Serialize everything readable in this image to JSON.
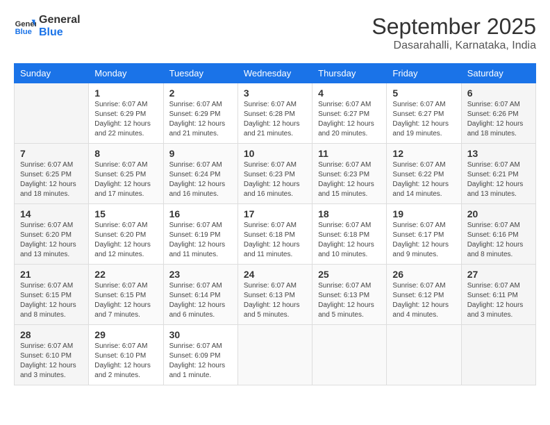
{
  "header": {
    "logo_line1": "General",
    "logo_line2": "Blue",
    "month": "September 2025",
    "location": "Dasarahalli, Karnataka, India"
  },
  "days_of_week": [
    "Sunday",
    "Monday",
    "Tuesday",
    "Wednesday",
    "Thursday",
    "Friday",
    "Saturday"
  ],
  "weeks": [
    [
      {
        "num": "",
        "empty": true
      },
      {
        "num": "1",
        "sunrise": "6:07 AM",
        "sunset": "6:29 PM",
        "daylight": "12 hours and 22 minutes."
      },
      {
        "num": "2",
        "sunrise": "6:07 AM",
        "sunset": "6:29 PM",
        "daylight": "12 hours and 21 minutes."
      },
      {
        "num": "3",
        "sunrise": "6:07 AM",
        "sunset": "6:28 PM",
        "daylight": "12 hours and 21 minutes."
      },
      {
        "num": "4",
        "sunrise": "6:07 AM",
        "sunset": "6:27 PM",
        "daylight": "12 hours and 20 minutes."
      },
      {
        "num": "5",
        "sunrise": "6:07 AM",
        "sunset": "6:27 PM",
        "daylight": "12 hours and 19 minutes."
      },
      {
        "num": "6",
        "sunrise": "6:07 AM",
        "sunset": "6:26 PM",
        "daylight": "12 hours and 18 minutes."
      }
    ],
    [
      {
        "num": "7",
        "sunrise": "6:07 AM",
        "sunset": "6:25 PM",
        "daylight": "12 hours and 18 minutes."
      },
      {
        "num": "8",
        "sunrise": "6:07 AM",
        "sunset": "6:25 PM",
        "daylight": "12 hours and 17 minutes."
      },
      {
        "num": "9",
        "sunrise": "6:07 AM",
        "sunset": "6:24 PM",
        "daylight": "12 hours and 16 minutes."
      },
      {
        "num": "10",
        "sunrise": "6:07 AM",
        "sunset": "6:23 PM",
        "daylight": "12 hours and 16 minutes."
      },
      {
        "num": "11",
        "sunrise": "6:07 AM",
        "sunset": "6:23 PM",
        "daylight": "12 hours and 15 minutes."
      },
      {
        "num": "12",
        "sunrise": "6:07 AM",
        "sunset": "6:22 PM",
        "daylight": "12 hours and 14 minutes."
      },
      {
        "num": "13",
        "sunrise": "6:07 AM",
        "sunset": "6:21 PM",
        "daylight": "12 hours and 13 minutes."
      }
    ],
    [
      {
        "num": "14",
        "sunrise": "6:07 AM",
        "sunset": "6:20 PM",
        "daylight": "12 hours and 13 minutes."
      },
      {
        "num": "15",
        "sunrise": "6:07 AM",
        "sunset": "6:20 PM",
        "daylight": "12 hours and 12 minutes."
      },
      {
        "num": "16",
        "sunrise": "6:07 AM",
        "sunset": "6:19 PM",
        "daylight": "12 hours and 11 minutes."
      },
      {
        "num": "17",
        "sunrise": "6:07 AM",
        "sunset": "6:18 PM",
        "daylight": "12 hours and 11 minutes."
      },
      {
        "num": "18",
        "sunrise": "6:07 AM",
        "sunset": "6:18 PM",
        "daylight": "12 hours and 10 minutes."
      },
      {
        "num": "19",
        "sunrise": "6:07 AM",
        "sunset": "6:17 PM",
        "daylight": "12 hours and 9 minutes."
      },
      {
        "num": "20",
        "sunrise": "6:07 AM",
        "sunset": "6:16 PM",
        "daylight": "12 hours and 8 minutes."
      }
    ],
    [
      {
        "num": "21",
        "sunrise": "6:07 AM",
        "sunset": "6:15 PM",
        "daylight": "12 hours and 8 minutes."
      },
      {
        "num": "22",
        "sunrise": "6:07 AM",
        "sunset": "6:15 PM",
        "daylight": "12 hours and 7 minutes."
      },
      {
        "num": "23",
        "sunrise": "6:07 AM",
        "sunset": "6:14 PM",
        "daylight": "12 hours and 6 minutes."
      },
      {
        "num": "24",
        "sunrise": "6:07 AM",
        "sunset": "6:13 PM",
        "daylight": "12 hours and 5 minutes."
      },
      {
        "num": "25",
        "sunrise": "6:07 AM",
        "sunset": "6:13 PM",
        "daylight": "12 hours and 5 minutes."
      },
      {
        "num": "26",
        "sunrise": "6:07 AM",
        "sunset": "6:12 PM",
        "daylight": "12 hours and 4 minutes."
      },
      {
        "num": "27",
        "sunrise": "6:07 AM",
        "sunset": "6:11 PM",
        "daylight": "12 hours and 3 minutes."
      }
    ],
    [
      {
        "num": "28",
        "sunrise": "6:07 AM",
        "sunset": "6:10 PM",
        "daylight": "12 hours and 3 minutes."
      },
      {
        "num": "29",
        "sunrise": "6:07 AM",
        "sunset": "6:10 PM",
        "daylight": "12 hours and 2 minutes."
      },
      {
        "num": "30",
        "sunrise": "6:07 AM",
        "sunset": "6:09 PM",
        "daylight": "12 hours and 1 minute."
      },
      {
        "num": "",
        "empty": true
      },
      {
        "num": "",
        "empty": true
      },
      {
        "num": "",
        "empty": true
      },
      {
        "num": "",
        "empty": true
      }
    ]
  ]
}
